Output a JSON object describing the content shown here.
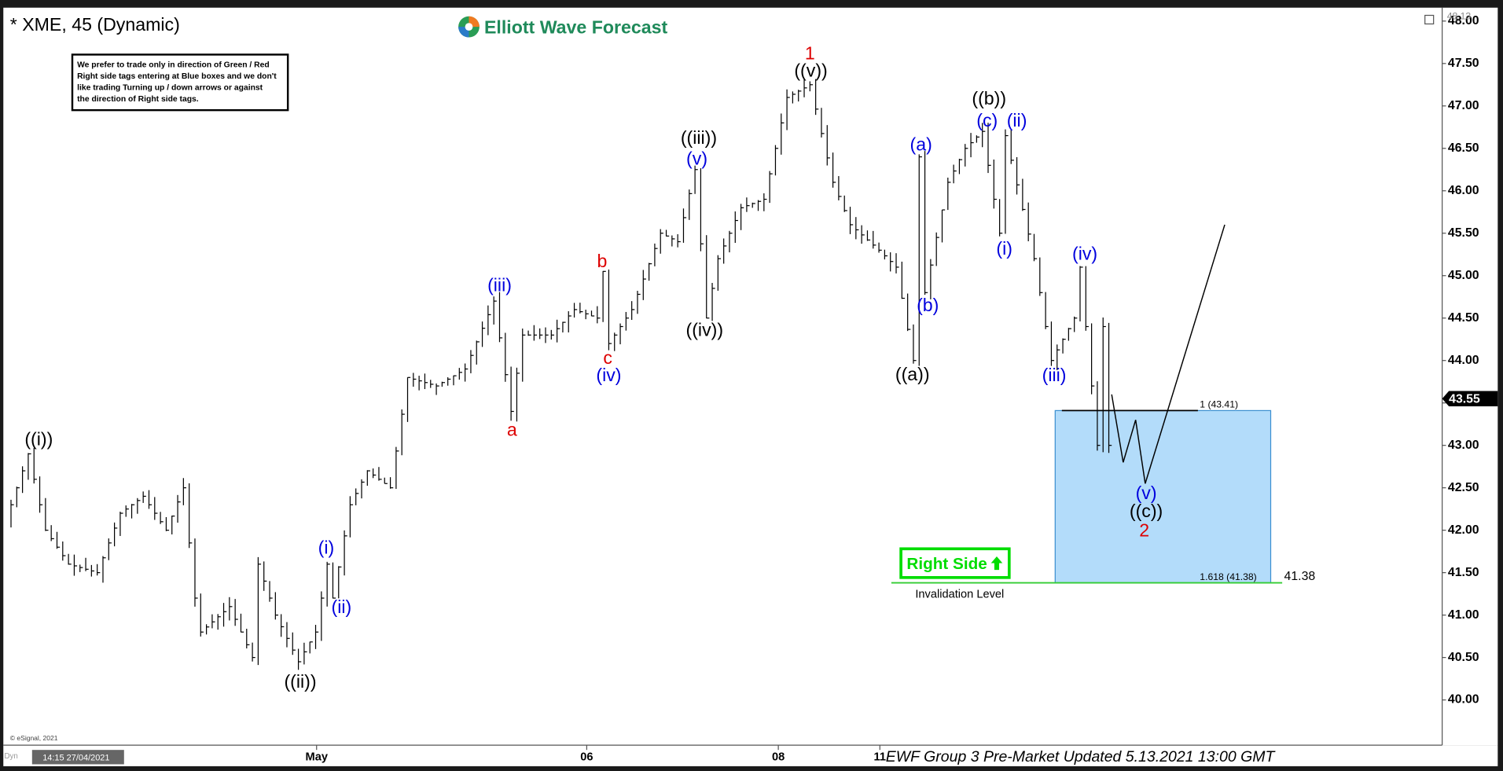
{
  "chart_title": "* XME, 45 (Dynamic)",
  "logo_text": "Elliott Wave Forecast",
  "note_lines": [
    "We prefer to trade only in direction of Green / Red",
    "Right side tags entering at Blue boxes and we don't",
    "like trading Turning up / down arrows or against",
    "the direction of Right side tags."
  ],
  "right_side_label": "Right Side",
  "invalidation_label": "Invalidation Level",
  "invalidation_value": "41.38",
  "fib_1_label": "1 (43.41)",
  "fib_1618_label": "1.618 (41.38)",
  "current_price": "43.55",
  "top_price": "48.13",
  "copyright": "© eSignal, 2021",
  "footer": "EWF Group 3 Pre-Market Updated 5.13.2021 13:00 GMT",
  "cursor_time": "14:15 27/04/2021",
  "dyn_label": "Dyn",
  "colors": {
    "blue_box": "#b3dcfa",
    "blue_label": "#0000dd",
    "red_label": "#dd0000",
    "right_side_green": "#00dd00",
    "invalidation_line": "#33cc33"
  },
  "chart_data": {
    "type": "bar",
    "symbol": "XME",
    "interval": "45",
    "ylim": [
      39.7,
      48.2
    ],
    "y_ticks": [
      "48.00",
      "47.50",
      "47.00",
      "46.50",
      "46.00",
      "45.50",
      "45.00",
      "44.50",
      "44.00",
      "43.50",
      "43.00",
      "42.50",
      "42.00",
      "41.50",
      "41.00",
      "40.50",
      "40.00"
    ],
    "x_ticks": [
      "May",
      "06",
      "08",
      "11"
    ],
    "price_pivots_bar_price": [
      [
        0,
        42.1
      ],
      [
        4,
        42.9
      ],
      [
        7,
        42.0
      ],
      [
        11,
        41.6
      ],
      [
        16,
        41.5
      ],
      [
        20,
        42.2
      ],
      [
        24,
        42.4
      ],
      [
        28,
        42.0
      ],
      [
        31,
        42.5
      ],
      [
        33,
        41.2
      ],
      [
        34,
        40.8
      ],
      [
        39,
        41.1
      ],
      [
        43,
        40.5
      ],
      [
        44,
        41.6
      ],
      [
        47,
        41.0
      ],
      [
        51,
        40.45
      ],
      [
        54,
        40.8
      ],
      [
        56,
        41.6
      ],
      [
        57,
        41.2
      ],
      [
        60,
        42.3
      ],
      [
        63,
        42.7
      ],
      [
        67,
        42.5
      ],
      [
        70,
        43.8
      ],
      [
        75,
        43.7
      ],
      [
        80,
        43.9
      ],
      [
        85,
        44.7
      ],
      [
        88,
        43.4
      ],
      [
        90,
        44.3
      ],
      [
        95,
        44.3
      ],
      [
        99,
        44.6
      ],
      [
        103,
        44.5
      ],
      [
        104,
        45.05
      ],
      [
        105,
        44.2
      ],
      [
        109,
        44.6
      ],
      [
        114,
        45.5
      ],
      [
        117,
        45.4
      ],
      [
        120,
        46.25
      ],
      [
        122,
        44.5
      ],
      [
        124,
        45.2
      ],
      [
        128,
        45.8
      ],
      [
        132,
        45.9
      ],
      [
        136,
        47.1
      ],
      [
        140,
        47.25
      ],
      [
        144,
        46.1
      ],
      [
        147,
        45.6
      ],
      [
        152,
        45.3
      ],
      [
        155,
        45.1
      ],
      [
        158,
        44.0
      ],
      [
        159,
        46.4
      ],
      [
        160,
        44.8
      ],
      [
        164,
        46.1
      ],
      [
        167,
        46.5
      ],
      [
        170,
        46.7
      ],
      [
        173,
        45.5
      ],
      [
        174,
        46.65
      ],
      [
        179,
        45.2
      ],
      [
        182,
        44.0
      ],
      [
        186,
        44.5
      ],
      [
        187,
        45.1
      ],
      [
        190,
        43.0
      ],
      [
        191,
        44.4
      ],
      [
        192,
        43.0
      ]
    ],
    "projection_path_price": [
      43.6,
      42.8,
      43.3,
      42.55,
      45.6
    ],
    "blue_box_range": [
      41.38,
      43.41
    ],
    "wave_labels": [
      {
        "text": "((i))",
        "color": "black"
      },
      {
        "text": "((ii))",
        "color": "black"
      },
      {
        "text": "(i)",
        "color": "blue"
      },
      {
        "text": "(ii)",
        "color": "blue"
      },
      {
        "text": "(iii)",
        "color": "blue"
      },
      {
        "text": "a",
        "color": "red"
      },
      {
        "text": "b",
        "color": "red"
      },
      {
        "text": "c",
        "color": "red"
      },
      {
        "text": "(iv)",
        "color": "blue"
      },
      {
        "text": "((iii))",
        "color": "black"
      },
      {
        "text": "(v)",
        "color": "blue"
      },
      {
        "text": "((iv))",
        "color": "black"
      },
      {
        "text": "1",
        "color": "red"
      },
      {
        "text": "((v))",
        "color": "black"
      },
      {
        "text": "(a)",
        "color": "blue"
      },
      {
        "text": "(b)",
        "color": "blue"
      },
      {
        "text": "((a))",
        "color": "black"
      },
      {
        "text": "((b))",
        "color": "black"
      },
      {
        "text": "(c)",
        "color": "blue"
      },
      {
        "text": "(ii)",
        "color": "blue"
      },
      {
        "text": "(i)",
        "color": "blue"
      },
      {
        "text": "(iii)",
        "color": "blue"
      },
      {
        "text": "(iv)",
        "color": "blue"
      },
      {
        "text": "(v)",
        "color": "blue"
      },
      {
        "text": "((c))",
        "color": "black"
      },
      {
        "text": "2",
        "color": "red"
      }
    ]
  }
}
